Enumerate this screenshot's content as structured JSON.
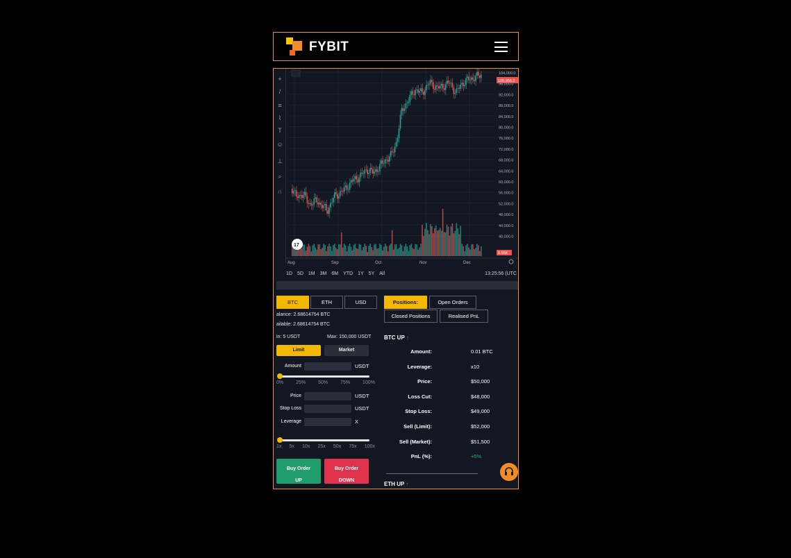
{
  "header": {
    "brand": "FYBIT",
    "menu_icon": "hamburger-icon"
  },
  "chart": {
    "y_labels": [
      "104,000.0",
      "96,000.0",
      "92,000.0",
      "88,000.0",
      "84,000.0",
      "80,000.0",
      "76,000.0",
      "72,000.0",
      "68,000.0",
      "64,000.0",
      "60,000.0",
      "56,000.0",
      "52,000.0",
      "48,000.0",
      "44,000.0",
      "40,000.0"
    ],
    "price_tag": "100,956.2",
    "volume_tag": "8.95K",
    "x_labels": [
      "Aug",
      "Sep",
      "Oct",
      "Nov",
      "Dec"
    ],
    "timeframes": [
      "1D",
      "5D",
      "1M",
      "3M",
      "6M",
      "YTD",
      "1Y",
      "5Y",
      "All"
    ],
    "clock": "13:25:56 (UTC",
    "up_color": "#26a69a",
    "down_color": "#ef5350"
  },
  "order": {
    "currencies": [
      "BTC",
      "ETH",
      "USD"
    ],
    "active_currency": "BTC",
    "balance": "alance: 2.68614754 BTC",
    "available": "ailable: 2.68614754 BTC",
    "min": "in: 5 USDT",
    "max": "Max: 150,000 USDT",
    "limit_label": "Limit",
    "market_label": "Market",
    "amount_label": "Amount",
    "amount_unit": "USDT",
    "amount_ticks": [
      "0%",
      "25%",
      "50%",
      "75%",
      "100%"
    ],
    "price_label": "Price",
    "price_unit": "USDT",
    "stoploss_label": "Stop Loss",
    "stoploss_unit": "USDT",
    "leverage_label": "Leverage",
    "leverage_unit": "X",
    "leverage_ticks": [
      "1x",
      "5x",
      "10x",
      "25x",
      "50x",
      "75x",
      "100x"
    ],
    "buy_up_line1": "Buy Order",
    "buy_up_line2": "UP",
    "buy_down_line1": "Buy Order",
    "buy_down_line2": "DOWN"
  },
  "positions": {
    "tabs": [
      "Positions:",
      "Open Orders",
      "Closed Positions",
      "Realised PnL"
    ],
    "btc_title": "BTC UP",
    "rows": [
      {
        "k": "Amount:",
        "v": "0.01 BTC"
      },
      {
        "k": "Leverage:",
        "v": "x10"
      },
      {
        "k": "Price:",
        "v": "$50,000"
      },
      {
        "k": "Loss Cut:",
        "v": "$48,000"
      },
      {
        "k": "Stop Loss:",
        "v": "$49,000"
      },
      {
        "k": "Sell (Limit):",
        "v": "$52,000"
      },
      {
        "k": "Sell (Market):",
        "v": "$51,500"
      },
      {
        "k": "PnL (%):",
        "v": "+5%"
      }
    ],
    "eth_title": "ETH UP",
    "support_icon": "headset-icon"
  }
}
